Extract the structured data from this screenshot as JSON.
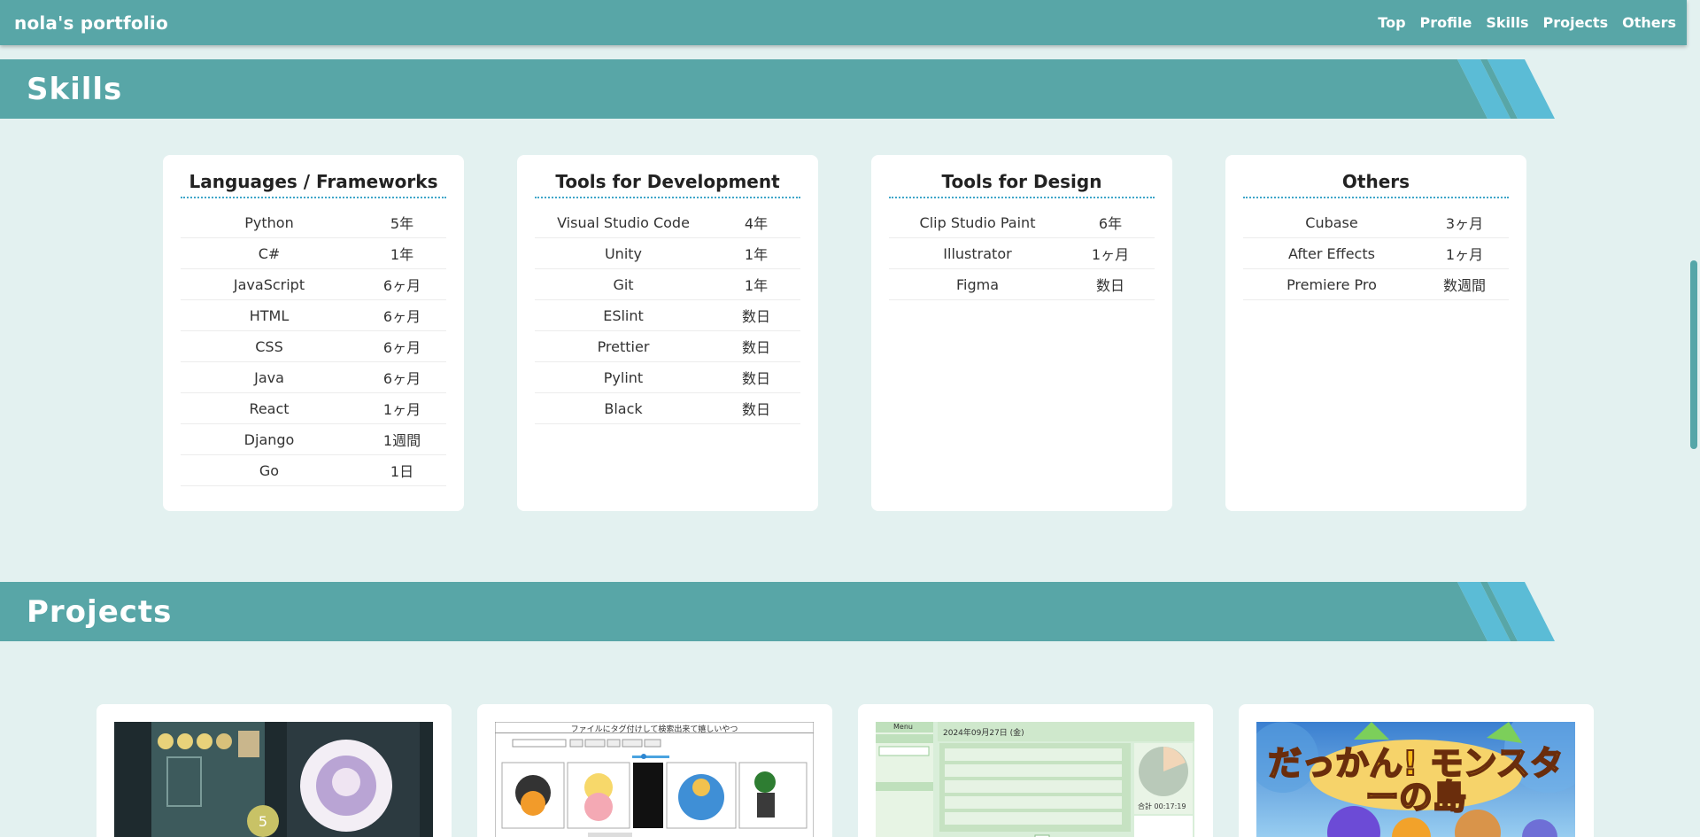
{
  "header": {
    "brand": "nola's portfolio",
    "nav": [
      "Top",
      "Profile",
      "Skills",
      "Projects",
      "Others"
    ]
  },
  "sections": {
    "skills_title": "Skills",
    "projects_title": "Projects"
  },
  "skills": [
    {
      "title": "Languages / Frameworks",
      "items": [
        {
          "name": "Python",
          "years": "5年"
        },
        {
          "name": "C#",
          "years": "1年"
        },
        {
          "name": "JavaScript",
          "years": "6ヶ月"
        },
        {
          "name": "HTML",
          "years": "6ヶ月"
        },
        {
          "name": "CSS",
          "years": "6ヶ月"
        },
        {
          "name": "Java",
          "years": "6ヶ月"
        },
        {
          "name": "React",
          "years": "1ヶ月"
        },
        {
          "name": "Django",
          "years": "1週間"
        },
        {
          "name": "Go",
          "years": "1日"
        }
      ]
    },
    {
      "title": "Tools for Development",
      "items": [
        {
          "name": "Visual Studio Code",
          "years": "4年"
        },
        {
          "name": "Unity",
          "years": "1年"
        },
        {
          "name": "Git",
          "years": "1年"
        },
        {
          "name": "ESlint",
          "years": "数日"
        },
        {
          "name": "Prettier",
          "years": "数日"
        },
        {
          "name": "Pylint",
          "years": "数日"
        },
        {
          "name": "Black",
          "years": "数日"
        }
      ]
    },
    {
      "title": "Tools for Design",
      "items": [
        {
          "name": "Clip Studio Paint",
          "years": "6年"
        },
        {
          "name": "Illustrator",
          "years": "1ヶ月"
        },
        {
          "name": "Figma",
          "years": "数日"
        }
      ]
    },
    {
      "title": "Others",
      "items": [
        {
          "name": "Cubase",
          "years": "3ヶ月"
        },
        {
          "name": "After Effects",
          "years": "1ヶ月"
        },
        {
          "name": "Premiere Pro",
          "years": "数週間"
        }
      ]
    }
  ],
  "projects": {
    "thumb2_caption": "ファイルにタグ付けして検索出来て嬉しいやつ",
    "thumb3_date": "2024年09月27日 (金)",
    "thumb3_menu": "Menu",
    "thumb3_total": "合計 00:17:19",
    "thumb4_title": "だっかん! モンスターの島"
  },
  "colors": {
    "teal": "#58a6a7",
    "banner_accent": "#5bbcd6",
    "background": "#e3f1f0"
  }
}
